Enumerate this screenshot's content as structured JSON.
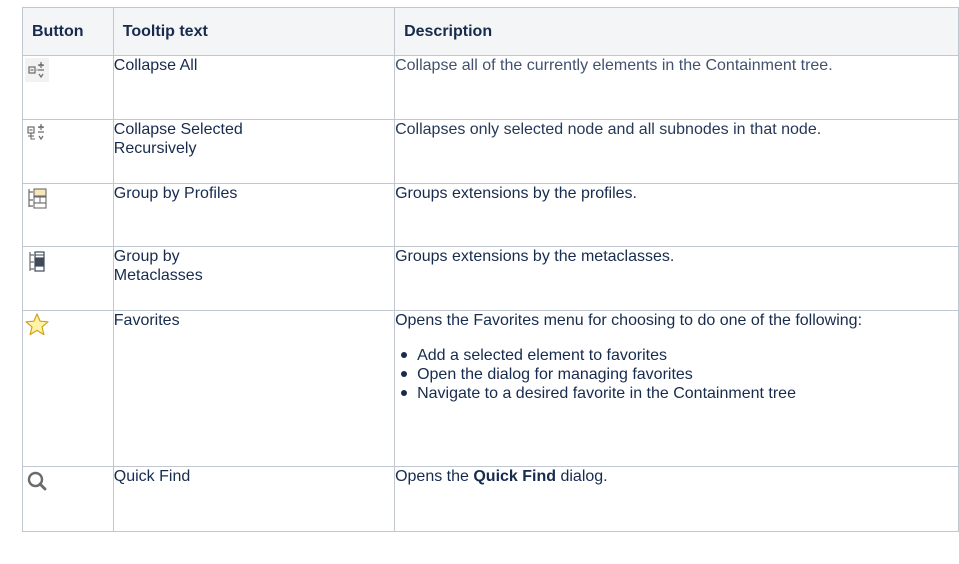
{
  "table": {
    "headers": {
      "button": "Button",
      "tooltip": "Tooltip text",
      "description": "Description"
    },
    "rows": [
      {
        "icon": "collapse-all-icon",
        "tooltip": "Collapse All",
        "description": "Collapse all of the currently elements in the Containment tree."
      },
      {
        "icon": "collapse-selected-recursively-icon",
        "tooltip": "Collapse Selected Recursively",
        "description": "Collapses only selected node and all subnodes in that node."
      },
      {
        "icon": "group-by-profiles-icon",
        "tooltip": "Group by Profiles",
        "description": "Groups extensions by the profiles."
      },
      {
        "icon": "group-by-metaclasses-icon",
        "tooltip": "Group by Metaclasses",
        "description": "Groups extensions by the metaclasses."
      },
      {
        "icon": "favorites-star-icon",
        "tooltip": "Favorites",
        "description": "Opens the Favorites menu for choosing to do one of the following:",
        "list": [
          "Add a selected element to favorites",
          "Open the dialog for managing favorites",
          "Navigate to a desired favorite in the Containment tree"
        ]
      },
      {
        "icon": "quick-find-search-icon",
        "tooltip": "Quick Find",
        "description_prefix": "Opens the ",
        "description_bold": "Quick Find",
        "description_suffix": " dialog."
      }
    ]
  },
  "colors": {
    "text": "#172b4d",
    "header_bg": "#f4f5f7",
    "border": "#c1c7d0",
    "icon_accent": "#e0a100"
  }
}
